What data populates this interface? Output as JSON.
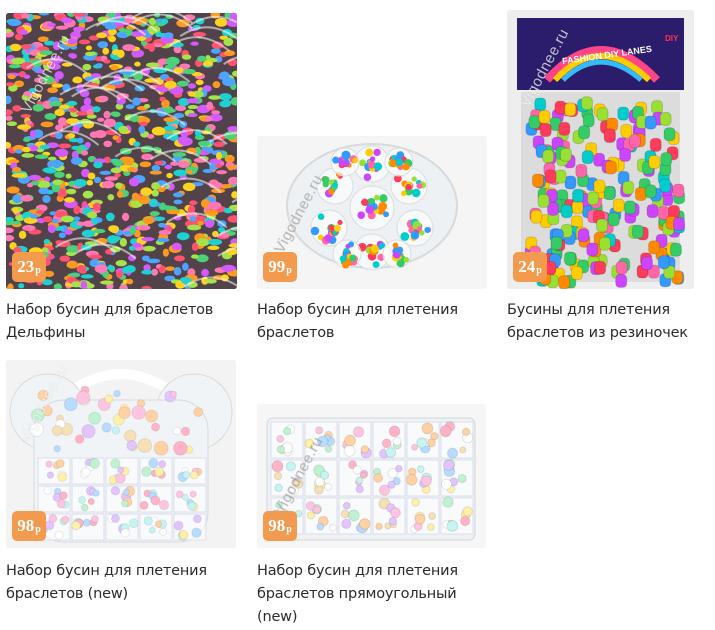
{
  "watermark": "Vigodnee.ru",
  "colors": {
    "price_badge": "#f29a4e",
    "title_text": "#2a2a2a"
  },
  "products": [
    {
      "title": "Набор бусин для браслетов Дельфины",
      "price": "23",
      "currency": "р",
      "image": "bag-of-dolphin-beads"
    },
    {
      "title": "Набор бусин для плетения браслетов",
      "price": "99",
      "currency": "р",
      "image": "round-flower-bead-box"
    },
    {
      "title": "Бусины для плетения браслетов из резиночек",
      "price": "24",
      "currency": "р",
      "image": "bag-of-pony-beads",
      "package_text": "FASHION DIY LANES",
      "package_tag": "DIY"
    },
    {
      "title": "Набор бусин для плетения браслетов (new)",
      "price": "98",
      "currency": "р",
      "image": "bear-shaped-bead-box"
    },
    {
      "title": "Набор бусин для плетения браслетов прямоугольный (new)",
      "price": "98",
      "currency": "р",
      "image": "rectangular-bead-box"
    }
  ]
}
